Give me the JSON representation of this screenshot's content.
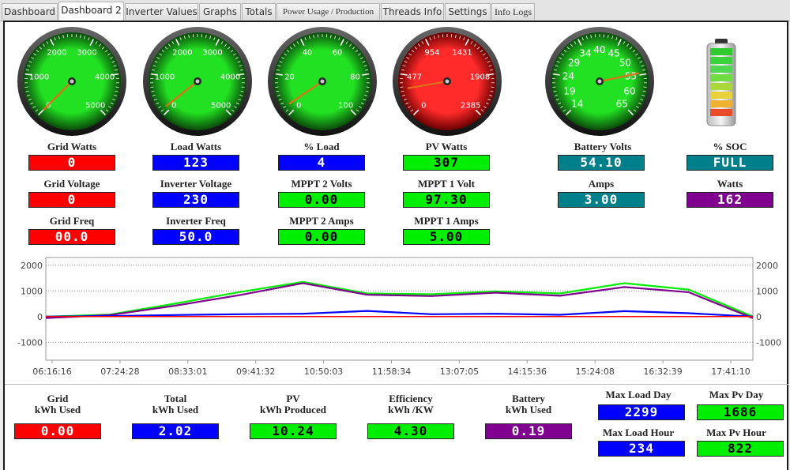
{
  "tabs": [
    {
      "label": "Dashboard",
      "active": false
    },
    {
      "label": "Dashboard 2",
      "active": true
    },
    {
      "label": "Inverter Values",
      "active": false
    },
    {
      "label": "Graphs",
      "active": false
    },
    {
      "label": "Totals",
      "active": false
    },
    {
      "label": "Power Usage / Production",
      "active": false
    },
    {
      "label": "Threads Info",
      "active": false
    },
    {
      "label": "Settings",
      "active": false
    },
    {
      "label": "Info Logs",
      "active": false
    }
  ],
  "gauges": [
    {
      "name": "grid-watts-gauge",
      "face": "green",
      "ticks": [
        "0",
        "1000",
        "2000",
        "3000",
        "4000",
        "5000"
      ],
      "value_fraction": 0.0
    },
    {
      "name": "load-watts-gauge",
      "face": "green",
      "ticks": [
        "0",
        "1000",
        "2000",
        "3000",
        "4000",
        "5000"
      ],
      "value_fraction": 0.025
    },
    {
      "name": "percent-load-gauge",
      "face": "green",
      "ticks": [
        "0",
        "20",
        "40",
        "60",
        "80",
        "100"
      ],
      "value_fraction": 0.04
    },
    {
      "name": "pv-watts-gauge",
      "face": "red",
      "ticks": [
        "0",
        "477",
        "954",
        "1431",
        "1908",
        "2385"
      ],
      "value_fraction": 0.13
    },
    {
      "name": "battery-volts-gauge",
      "face": "green",
      "ticks": [
        "14",
        "19",
        "24",
        "29",
        "34",
        "40",
        "45",
        "50",
        "55",
        "60",
        "65"
      ],
      "value_fraction": 0.79
    }
  ],
  "battery_icon": {
    "soc": "full"
  },
  "labels": {
    "grid_watts": "Grid Watts",
    "load_watts": "Load Watts",
    "pct_load": "% Load",
    "pv_watts": "PV Watts",
    "battery_volts": "Battery Volts",
    "pct_soc": "% SOC",
    "grid_voltage": "Grid Voltage",
    "inverter_voltage": "Inverter Voltage",
    "mppt2_volts": "MPPT 2 Volts",
    "mppt1_volt": "MPPT 1 Volt",
    "amps": "Amps",
    "watts": "Watts",
    "grid_freq": "Grid Freq",
    "inverter_freq": "Inverter Freq",
    "mppt2_amps": "MPPT 2 Amps",
    "mppt1_amps": "MPPT 1 Amps"
  },
  "values": {
    "grid_watts": "0",
    "load_watts": "123",
    "pct_load": "4",
    "pv_watts": "307",
    "battery_volts": "54.10",
    "pct_soc": "FULL",
    "grid_voltage": "0",
    "inverter_voltage": "230",
    "mppt2_volts": "0.00",
    "mppt1_volt": "97.30",
    "amps": "3.00",
    "watts": "162",
    "grid_freq": "00.0",
    "inverter_freq": "50.0",
    "mppt2_amps": "0.00",
    "mppt1_amps": "5.00"
  },
  "totals": {
    "grid_l1": "Grid",
    "grid_l2": "kWh Used",
    "grid_value": "0.00",
    "total_l1": "Total",
    "total_l2": "kWh Used",
    "total_value": "2.02",
    "pv_l1": "PV",
    "pv_l2": "kWh Produced",
    "pv_value": "10.24",
    "eff_l1": "Efficiency",
    "eff_l2": "kWh /KW",
    "eff_value": "4.30",
    "batt_l1": "Battery",
    "batt_l2": "kWh Used",
    "batt_value": "0.19",
    "max_load_day_label": "Max Load Day",
    "max_load_day": "2299",
    "max_pv_day_label": "Max Pv Day",
    "max_pv_day": "1686",
    "max_load_hour_label": "Max Load Hour",
    "max_load_hour": "234",
    "max_pv_hour_label": "Max Pv Hour",
    "max_pv_hour": "822"
  },
  "colors": {
    "grid": "#ff0000",
    "load": "#0000ff",
    "pv": "#00ee00",
    "battery": "#800090",
    "battery_volts": "#00808a"
  },
  "chart_data": {
    "type": "line",
    "x": [
      "06:16:16",
      "07:24:28",
      "08:33:01",
      "09:41:32",
      "10:50:03",
      "11:58:34",
      "13:07:05",
      "14:15:36",
      "15:24:08",
      "16:32:39",
      "17:41:10"
    ],
    "y_ticks": [
      "2000",
      "1000",
      "0",
      "-1000"
    ],
    "ylim": [
      -1700,
      2300
    ],
    "grid": true,
    "series": [
      {
        "color": "#00ee00",
        "values": [
          0,
          80,
          500,
          950,
          1350,
          900,
          870,
          980,
          900,
          1300,
          1050,
          0
        ]
      },
      {
        "color": "#800090",
        "values": [
          -60,
          60,
          420,
          830,
          1300,
          850,
          800,
          930,
          810,
          1150,
          950,
          -60
        ]
      },
      {
        "color": "#0000ff",
        "values": [
          0,
          20,
          60,
          90,
          110,
          220,
          90,
          110,
          70,
          210,
          130,
          0
        ]
      },
      {
        "color": "#ff0000",
        "values": [
          0,
          0,
          0,
          0,
          0,
          0,
          0,
          0,
          0,
          0,
          0,
          0
        ]
      }
    ]
  }
}
